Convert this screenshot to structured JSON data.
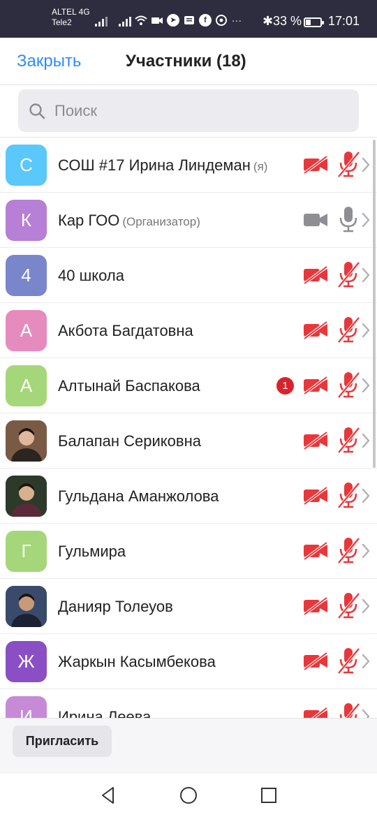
{
  "status_bar": {
    "carrier_top": "ALTEL 4G",
    "carrier_bottom": "Tele2",
    "battery_pct": "33 %",
    "battery_level": 0.33,
    "time": "17:01",
    "more": "···"
  },
  "header": {
    "close_label": "Закрыть",
    "title": "Участники (18)"
  },
  "search": {
    "placeholder": "Поиск",
    "value": ""
  },
  "participants": [
    {
      "initial": "С",
      "name": "СОШ #17 Ирина Линдеман",
      "role": "(я)",
      "avatar_color": "#5ac8fa",
      "video": "off",
      "mic": "off"
    },
    {
      "initial": "К",
      "name": "Кар ГОО",
      "role": "(Организатор)",
      "avatar_color": "#b77fd6",
      "video": "on",
      "mic": "on"
    },
    {
      "initial": "4",
      "name": "40 школа",
      "role": "",
      "avatar_color": "#7a86cc",
      "video": "off",
      "mic": "off"
    },
    {
      "initial": "А",
      "name": "Акбота Багдатовна",
      "role": "",
      "avatar_color": "#e68bbd",
      "video": "off",
      "mic": "off"
    },
    {
      "initial": "А",
      "name": "Алтынай Баспакова",
      "role": "",
      "avatar_color": "#a5d77a",
      "video": "off",
      "mic": "off",
      "badge": "1"
    },
    {
      "initial": "",
      "name": "Балапан Сериковна",
      "role": "",
      "avatar_color": "#6b4a3a",
      "video": "off",
      "mic": "off",
      "photo": true
    },
    {
      "initial": "",
      "name": "Гульдана Аманжолова",
      "role": "",
      "avatar_color": "#3a3d2a",
      "video": "off",
      "mic": "off",
      "photo": true
    },
    {
      "initial": "Г",
      "name": "Гульмира",
      "role": "",
      "avatar_color": "#a5d77a",
      "video": "off",
      "mic": "off"
    },
    {
      "initial": "",
      "name": "Данияр Толеуов",
      "role": "",
      "avatar_color": "#2a3550",
      "video": "off",
      "mic": "off",
      "photo": true
    },
    {
      "initial": "Ж",
      "name": "Жаркын Касымбекова",
      "role": "",
      "avatar_color": "#8a4fc4",
      "video": "off",
      "mic": "off"
    },
    {
      "initial": "И",
      "name": "Ирина Леева",
      "role": "",
      "avatar_color": "#c78ad6",
      "video": "off",
      "mic": "off"
    }
  ],
  "bottom_bar": {
    "invite_label": "Пригласить"
  },
  "colors": {
    "accent": "#2d8cff",
    "muted_red": "#e8373b",
    "active_gray": "#8e8e93"
  }
}
